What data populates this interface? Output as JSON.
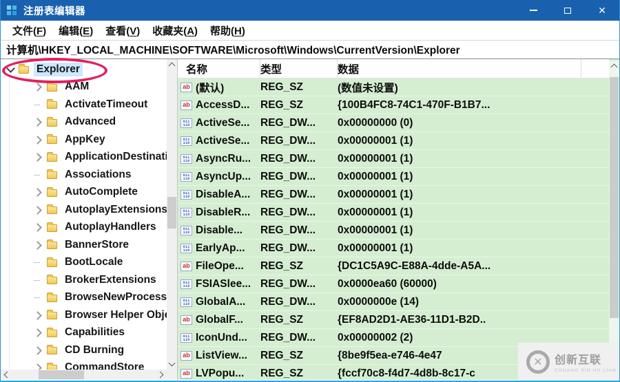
{
  "window": {
    "title": "注册表编辑器",
    "controls": [
      {
        "name": "minimize"
      },
      {
        "name": "maximize"
      },
      {
        "name": "close"
      }
    ]
  },
  "menu": {
    "items": [
      {
        "pre": "文件(",
        "key": "F",
        "post": ")"
      },
      {
        "pre": "编辑(",
        "key": "E",
        "post": ")"
      },
      {
        "pre": "查看(",
        "key": "V",
        "post": ")"
      },
      {
        "pre": "收藏夹(",
        "key": "A",
        "post": ")"
      },
      {
        "pre": "帮助(",
        "key": "H",
        "post": ")"
      }
    ]
  },
  "address": {
    "path": "计算机\\HKEY_LOCAL_MACHINE\\SOFTWARE\\Microsoft\\Windows\\CurrentVersion\\Explorer"
  },
  "tree": {
    "items": [
      {
        "label": "Explorer",
        "arrow": "expanded",
        "level": "lvl0",
        "state": "selected"
      },
      {
        "label": "AAM",
        "arrow": "collapsed",
        "level": "lvl1",
        "state": ""
      },
      {
        "label": "ActivateTimeout",
        "arrow": "none",
        "level": "lvl1",
        "state": ""
      },
      {
        "label": "Advanced",
        "arrow": "collapsed",
        "level": "lvl1",
        "state": ""
      },
      {
        "label": "AppKey",
        "arrow": "collapsed",
        "level": "lvl1",
        "state": ""
      },
      {
        "label": "ApplicationDestinati",
        "arrow": "collapsed",
        "level": "lvl1",
        "state": ""
      },
      {
        "label": "Associations",
        "arrow": "none",
        "level": "lvl1",
        "state": ""
      },
      {
        "label": "AutoComplete",
        "arrow": "collapsed",
        "level": "lvl1",
        "state": ""
      },
      {
        "label": "AutoplayExtensions",
        "arrow": "collapsed",
        "level": "lvl1",
        "state": ""
      },
      {
        "label": "AutoplayHandlers",
        "arrow": "collapsed",
        "level": "lvl1",
        "state": ""
      },
      {
        "label": "BannerStore",
        "arrow": "collapsed",
        "level": "lvl1",
        "state": ""
      },
      {
        "label": "BootLocale",
        "arrow": "none",
        "level": "lvl1",
        "state": ""
      },
      {
        "label": "BrokerExtensions",
        "arrow": "none",
        "level": "lvl1",
        "state": ""
      },
      {
        "label": "BrowseNewProcess",
        "arrow": "none",
        "level": "lvl1",
        "state": ""
      },
      {
        "label": "Browser Helper Obje",
        "arrow": "collapsed",
        "level": "lvl1",
        "state": ""
      },
      {
        "label": "Capabilities",
        "arrow": "collapsed",
        "level": "lvl1",
        "state": ""
      },
      {
        "label": "CD Burning",
        "arrow": "collapsed",
        "level": "lvl1",
        "state": ""
      },
      {
        "label": "CommandStore",
        "arrow": "collapsed",
        "level": "lvl1",
        "state": ""
      }
    ]
  },
  "list": {
    "columns": [
      "名称",
      "类型",
      "数据"
    ],
    "rows": [
      {
        "name": "(默认)",
        "icon": "icon-sz",
        "type": "REG_SZ",
        "data": "(数值未设置)"
      },
      {
        "name": "AccessD...",
        "icon": "icon-sz",
        "type": "REG_SZ",
        "data": "{100B4FC8-74C1-470F-B1B7..."
      },
      {
        "name": "ActiveSe...",
        "icon": "icon-dword",
        "type": "REG_DW...",
        "data": "0x00000000 (0)"
      },
      {
        "name": "ActiveSe...",
        "icon": "icon-dword",
        "type": "REG_DW...",
        "data": "0x00000001 (1)"
      },
      {
        "name": "AsyncRu...",
        "icon": "icon-dword",
        "type": "REG_DW...",
        "data": "0x00000001 (1)"
      },
      {
        "name": "AsyncUp...",
        "icon": "icon-dword",
        "type": "REG_DW...",
        "data": "0x00000001 (1)"
      },
      {
        "name": "DisableA...",
        "icon": "icon-dword",
        "type": "REG_DW...",
        "data": "0x00000001 (1)"
      },
      {
        "name": "DisableR...",
        "icon": "icon-dword",
        "type": "REG_DW...",
        "data": "0x00000001 (1)"
      },
      {
        "name": "Disable...",
        "icon": "icon-dword",
        "type": "REG_DW...",
        "data": "0x00000001 (1)"
      },
      {
        "name": "EarlyAp...",
        "icon": "icon-dword",
        "type": "REG_DW...",
        "data": "0x00000001 (1)"
      },
      {
        "name": "FileOpe...",
        "icon": "icon-sz",
        "type": "REG_SZ",
        "data": "{DC1C5A9C-E88A-4dde-A5A..."
      },
      {
        "name": "FSIASlee...",
        "icon": "icon-dword",
        "type": "REG_DW...",
        "data": "0x0000ea60 (60000)"
      },
      {
        "name": "GlobalA...",
        "icon": "icon-dword",
        "type": "REG_DW...",
        "data": "0x0000000e (14)"
      },
      {
        "name": "GlobalF...",
        "icon": "icon-sz",
        "type": "REG_SZ",
        "data": "{EF8AD2D1-AE36-11D1-B2D.."
      },
      {
        "name": "IconUnd...",
        "icon": "icon-dword",
        "type": "REG_DW...",
        "data": "0x00000002 (2)"
      },
      {
        "name": "ListView...",
        "icon": "icon-sz",
        "type": "REG_SZ",
        "data": "{8be9f5ea-e746-4e47"
      },
      {
        "name": "LVPopu...",
        "icon": "icon-sz",
        "type": "REG_SZ",
        "data": "{fccf70c8-f4d7-4d8b-8c17-c"
      }
    ]
  },
  "watermark": {
    "name": "创新互联",
    "sub": "CHUANG XIN HU LIAN"
  },
  "colors": {
    "titlebar": "#1961ae",
    "row_background": "#d5eed2",
    "selection": "#cbe8ff",
    "annotation": "#e41e5e",
    "window_border": "#27a5e2"
  }
}
